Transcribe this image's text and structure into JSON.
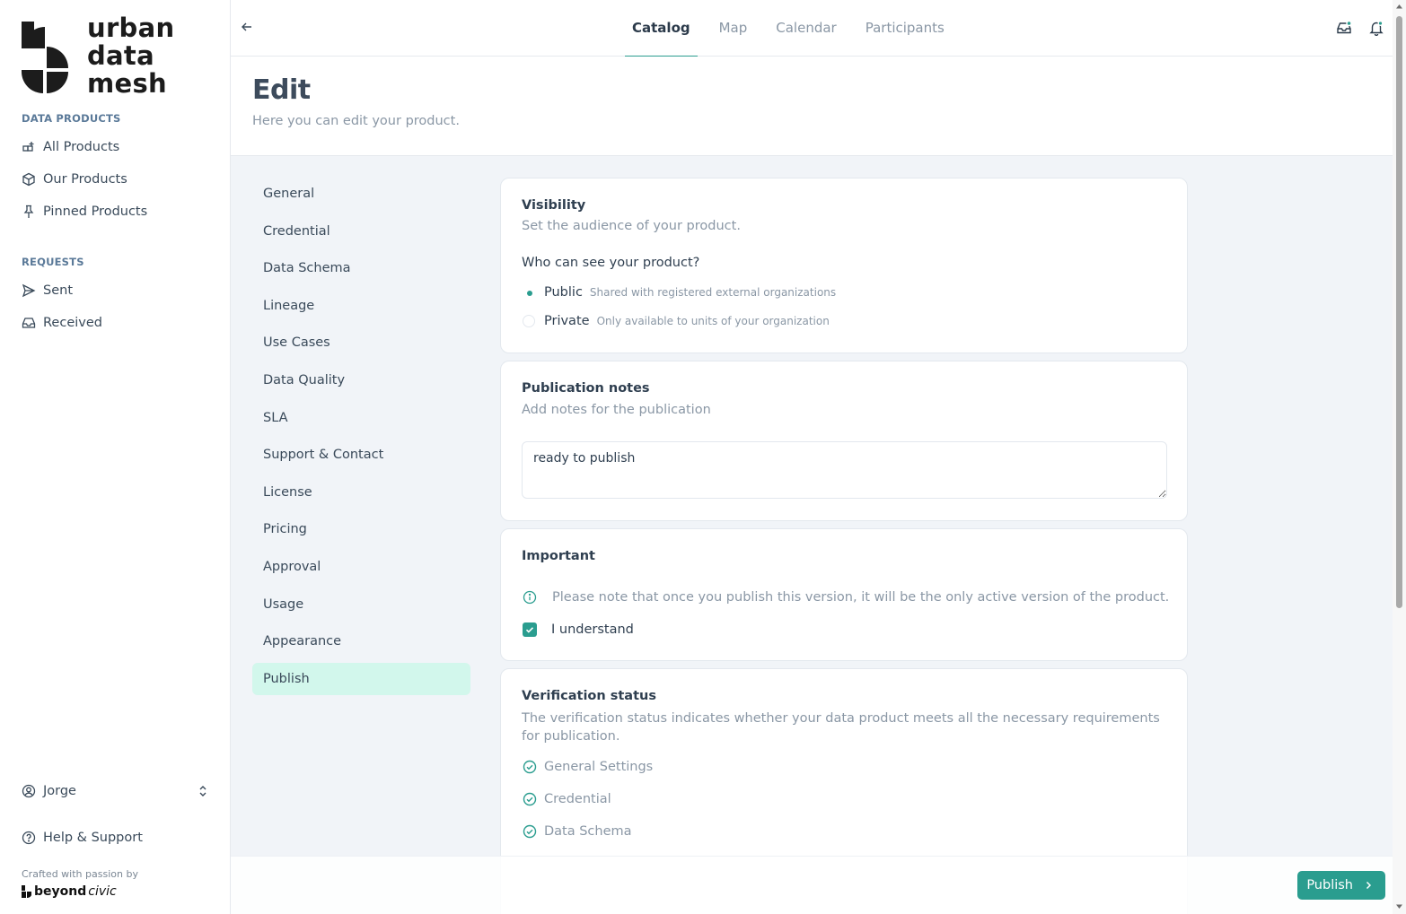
{
  "brand": {
    "logo_line1": "urban",
    "logo_line2": "data",
    "logo_line3": "mesh",
    "crafted": "Crafted with passion by",
    "footer_brand_bold": "beyond",
    "footer_brand_italic": "civic"
  },
  "sidebar": {
    "section_products": "DATA PRODUCTS",
    "all_products": "All Products",
    "our_products": "Our Products",
    "pinned_products": "Pinned Products",
    "section_requests": "REQUESTS",
    "sent": "Sent",
    "received": "Received",
    "user": "Jorge",
    "help": "Help & Support"
  },
  "topbar": {
    "tabs": [
      "Catalog",
      "Map",
      "Calendar",
      "Participants"
    ],
    "active_tab": "Catalog"
  },
  "header": {
    "title": "Edit",
    "subtitle": "Here you can edit your product."
  },
  "subnav": {
    "items": [
      "General",
      "Credential",
      "Data Schema",
      "Lineage",
      "Use Cases",
      "Data Quality",
      "SLA",
      "Support & Contact",
      "License",
      "Pricing",
      "Approval",
      "Usage",
      "Appearance",
      "Publish"
    ],
    "active": "Publish"
  },
  "visibility": {
    "title": "Visibility",
    "subtitle": "Set the audience of your product.",
    "question": "Who can see your product?",
    "public_label": "Public",
    "public_desc": "Shared with registered external organizations",
    "private_label": "Private",
    "private_desc": "Only available to units of your organization",
    "selected": "Public"
  },
  "publication_notes": {
    "title": "Publication notes",
    "subtitle": "Add notes for the publication",
    "value": "ready to publish"
  },
  "important": {
    "title": "Important",
    "note": "Please note that once you publish this version, it will be the only active version of the product.",
    "checkbox_label": "I understand",
    "checked": true
  },
  "verification": {
    "title": "Verification status",
    "subtitle": "The verification status indicates whether your data product meets all the necessary requirements for publication.",
    "items": [
      "General Settings",
      "Credential",
      "Data Schema"
    ]
  },
  "actions": {
    "publish": "Publish"
  },
  "colors": {
    "accent": "#2a9d8f",
    "active_bg": "#d2f7ec",
    "content_bg": "#f1f4f8"
  }
}
